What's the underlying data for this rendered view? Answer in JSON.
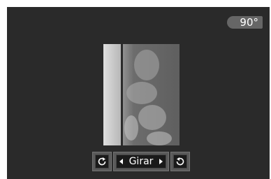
{
  "angle_badge": {
    "text": "90°"
  },
  "preview": {
    "image": "rotated-sky-photo"
  },
  "controls": {
    "rotate_left_icon": "rotate-counterclockwise-icon",
    "label": "Girar",
    "prev_icon": "triangle-left-icon",
    "next_icon": "triangle-right-icon",
    "rotate_right_icon": "rotate-clockwise-icon"
  },
  "colors": {
    "background": "#2a2a2a",
    "badge": "#666666",
    "control": "#5a5a5a"
  }
}
